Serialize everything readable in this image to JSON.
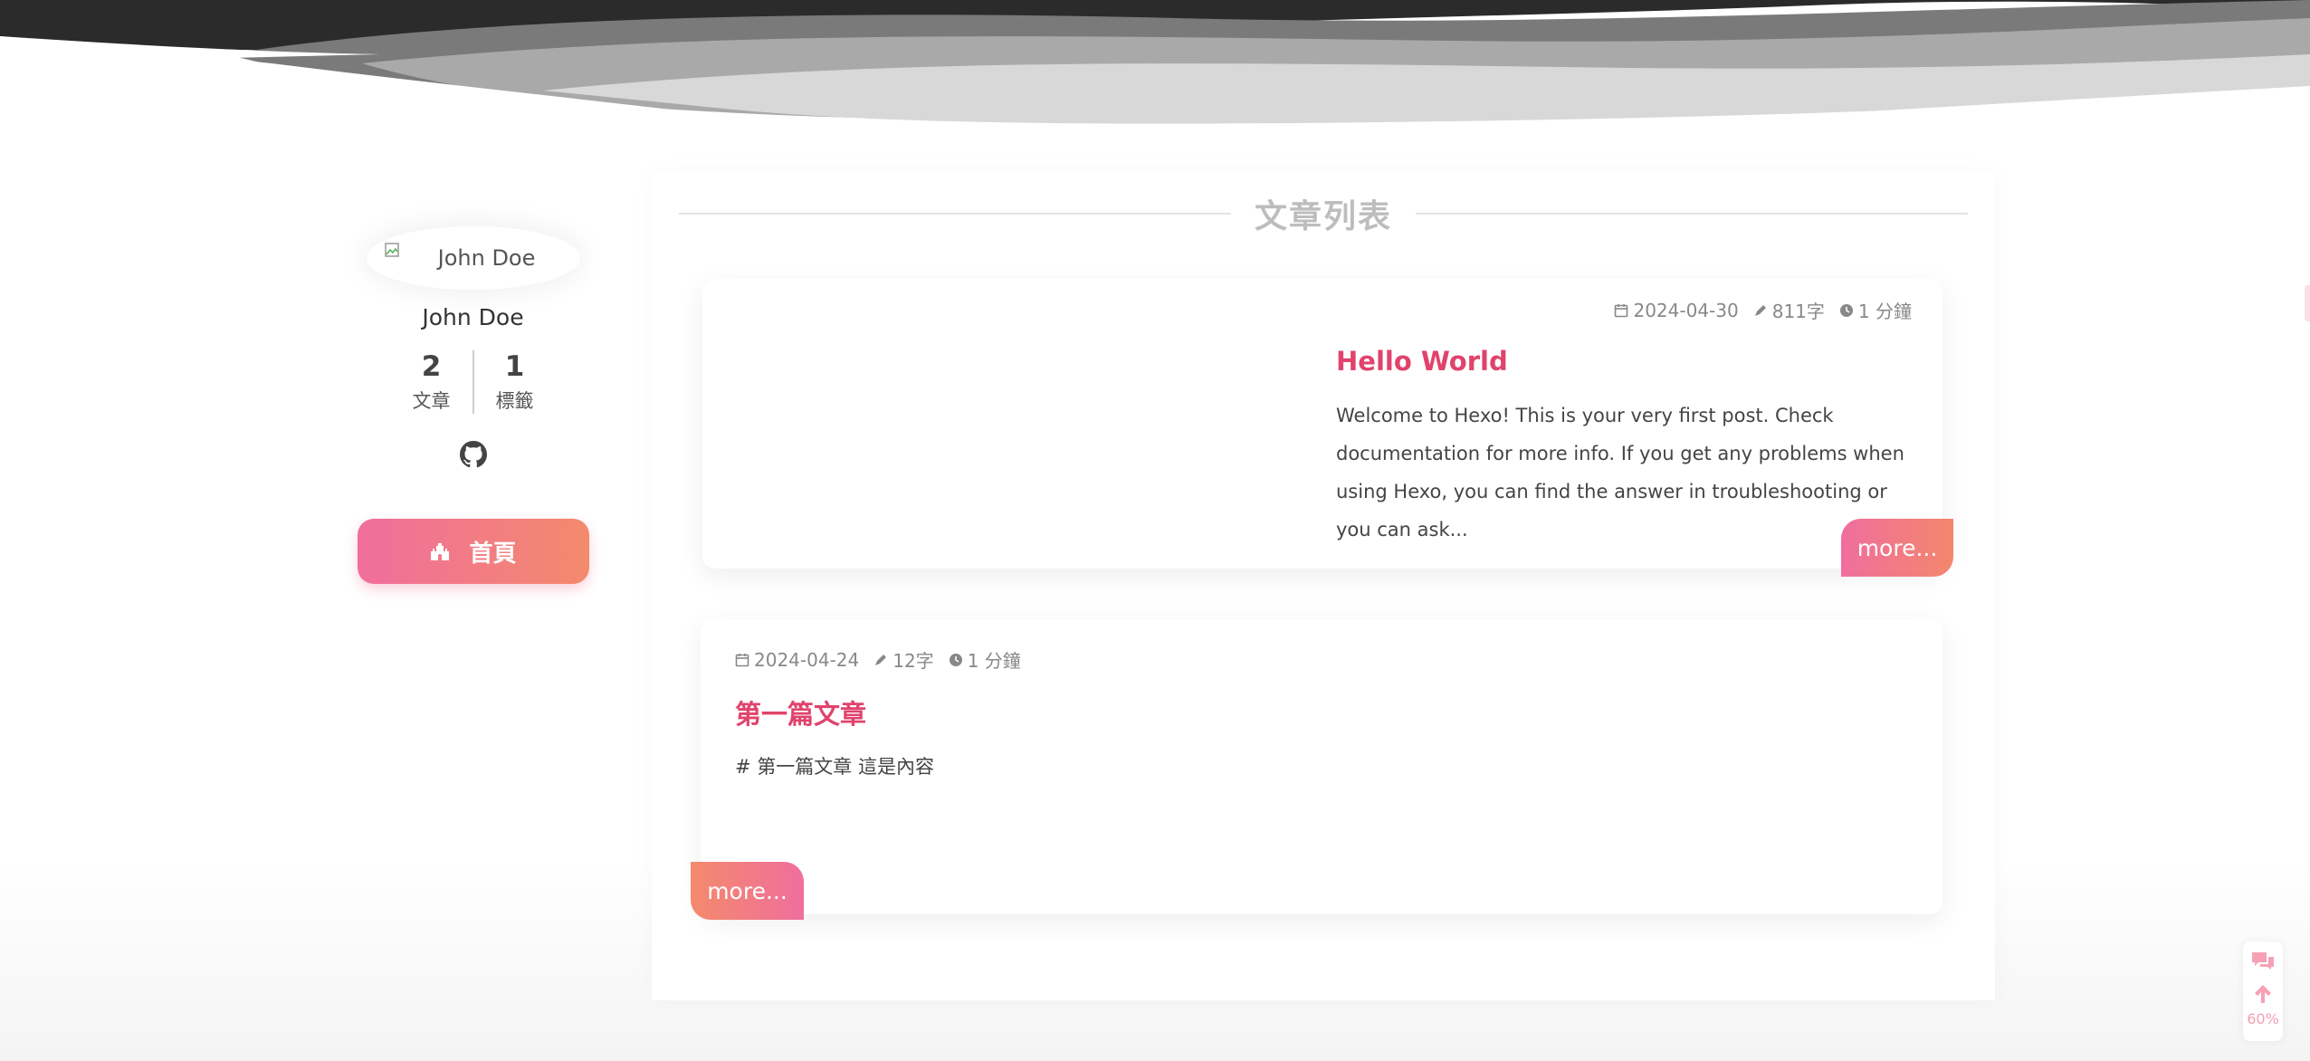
{
  "sidebar": {
    "author_name": "John Doe",
    "avatar_alt": "John Doe",
    "stats": [
      {
        "count": "2",
        "label": "文章"
      },
      {
        "count": "1",
        "label": "標籤"
      }
    ],
    "github_icon": "github-icon",
    "home_button_label": "首頁",
    "home_button_icon": "castle-icon"
  },
  "main": {
    "section_title": "文章列表",
    "posts": [
      {
        "date": "2024-04-30",
        "wordcount": "811字",
        "read_time": "1 分鐘",
        "title": "Hello World",
        "excerpt": "Welcome to Hexo! This is your very first post. Check documentation for more info. If you get any problems when using Hexo, you can find the answer in troubleshooting or you can ask...",
        "more_label": "more..."
      },
      {
        "date": "2024-04-24",
        "wordcount": "12字",
        "read_time": "1 分鐘",
        "title": "第一篇文章",
        "excerpt": "# 第一篇文章 這是內容",
        "more_label": "more..."
      }
    ]
  },
  "rightside": {
    "comment_icon": "comments-icon",
    "top_icon": "arrow-up-icon",
    "scroll_percent": "60%"
  },
  "colors": {
    "accent": "#e0436c",
    "gradient_pink": "#f06e9d",
    "gradient_orange": "#f38a6c",
    "header_dark": "#2a2a2a"
  }
}
